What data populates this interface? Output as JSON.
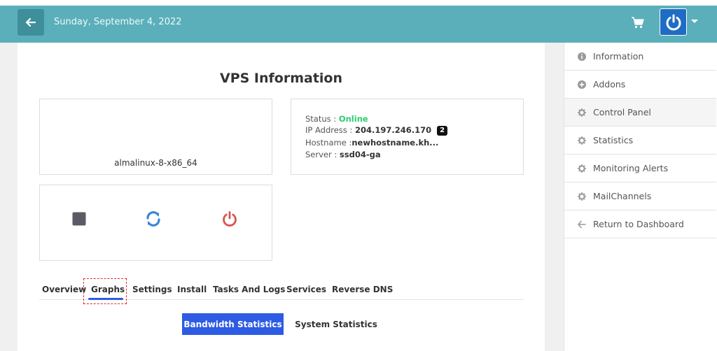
{
  "header": {
    "date": "Sunday, September 4, 2022",
    "back_icon": "arrow-left-icon",
    "cart_icon": "shopping-cart-icon",
    "power_icon": "power-icon",
    "accent_color": "#5aafbb"
  },
  "main": {
    "title": "VPS Information",
    "os_name": "almalinux-8-x86_64",
    "info": {
      "status_label": "Status : ",
      "status_value": "Online",
      "ip_label": "IP Address : ",
      "ip_value": "204.197.246.170",
      "ip_badge": "2",
      "hostname_label": "Hostname :",
      "hostname_value": "newhostname.kh...",
      "server_label": "Server : ",
      "server_value": "ssd04-ga"
    },
    "controls": [
      {
        "name": "stop-icon",
        "color": "#5b5b66"
      },
      {
        "name": "restart-icon",
        "color": "#3b86d8"
      },
      {
        "name": "power-off-icon",
        "color": "#d9534f"
      }
    ],
    "tabs": [
      {
        "label": "Overview"
      },
      {
        "label": "Graphs"
      },
      {
        "label": "Settings"
      },
      {
        "label": "Install"
      },
      {
        "label": "Tasks And Logs"
      },
      {
        "label": "Services"
      },
      {
        "label": "Reverse DNS"
      }
    ],
    "active_tab": "Graphs",
    "subtabs": {
      "bandwidth": "Bandwidth Statistics",
      "system": "System Statistics"
    }
  },
  "sidebar": {
    "items": [
      {
        "label": "Information",
        "icon": "info-circle-icon"
      },
      {
        "label": "Addons",
        "icon": "plus-circle-icon"
      },
      {
        "label": "Control Panel",
        "icon": "gear-icon"
      },
      {
        "label": "Statistics",
        "icon": "gear-icon"
      },
      {
        "label": "Monitoring Alerts",
        "icon": "gear-icon"
      },
      {
        "label": "MailChannels",
        "icon": "gear-icon"
      },
      {
        "label": "Return to Dashboard",
        "icon": "arrow-left-icon"
      }
    ],
    "active_item": "Control Panel"
  }
}
